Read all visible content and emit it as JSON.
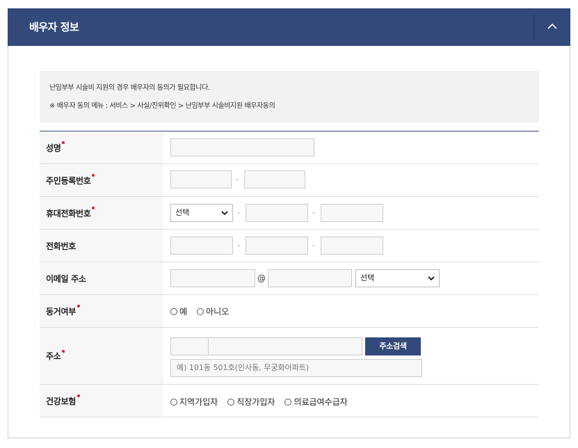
{
  "section": {
    "title": "배우자 정보",
    "collapse_icon": "chevron-up-icon"
  },
  "notice": {
    "line1": "난임부부 시술비 지원의 경우 배우자의 동의가 필요합니다.",
    "line2": "※ 배우자 동의 메뉴 : 서비스 > 사실/진위확인 > 난임부부 시술비지원 배우자동의"
  },
  "form": {
    "name": {
      "label": "성명",
      "required": true,
      "value": ""
    },
    "rrn": {
      "label": "주민등록번호",
      "required": true,
      "sep": "-",
      "part1": "",
      "part2": ""
    },
    "mobile": {
      "label": "휴대전화번호",
      "required": true,
      "select": "선택",
      "sep": "-",
      "part2": "",
      "part3": ""
    },
    "phone": {
      "label": "전화번호",
      "required": false,
      "sep": "-",
      "part1": "",
      "part2": "",
      "part3": ""
    },
    "email": {
      "label": "이메일 주소",
      "required": false,
      "at": "@",
      "local": "",
      "domain": "",
      "select": "선택"
    },
    "cohabit": {
      "label": "동거여부",
      "required": true,
      "options": [
        "예",
        "아니오"
      ]
    },
    "address": {
      "label": "주소",
      "required": true,
      "zip": "",
      "addr1": "",
      "search_btn": "주소검색",
      "detail_placeholder": "예) 101동 501호(인사동, 무궁화아파트)"
    },
    "insurance": {
      "label": "건강보험",
      "required": true,
      "options": [
        "지역가입자",
        "직장가입자",
        "의료급여수급자"
      ]
    }
  }
}
